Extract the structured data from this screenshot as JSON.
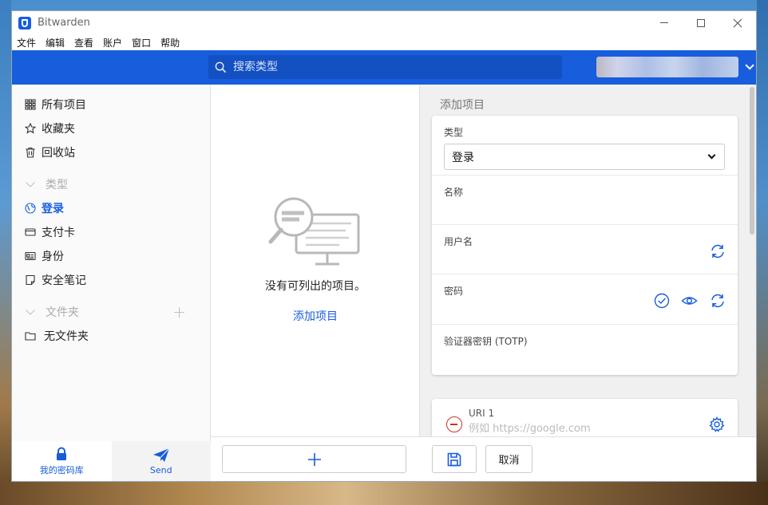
{
  "window": {
    "title": "Bitwarden"
  },
  "menu": [
    "文件",
    "编辑",
    "查看",
    "账户",
    "窗口",
    "帮助"
  ],
  "search": {
    "placeholder": "搜索类型"
  },
  "sidebar": {
    "items": [
      {
        "label": "所有项目",
        "icon": "grid-icon"
      },
      {
        "label": "收藏夹",
        "icon": "star-icon"
      },
      {
        "label": "回收站",
        "icon": "trash-icon"
      }
    ],
    "types_heading": "类型",
    "types": [
      {
        "label": "登录",
        "icon": "globe-icon",
        "active": true
      },
      {
        "label": "支付卡",
        "icon": "credit-card-icon"
      },
      {
        "label": "身份",
        "icon": "id-card-icon"
      },
      {
        "label": "安全笔记",
        "icon": "note-icon"
      }
    ],
    "folders_heading": "文件夹",
    "folders": [
      {
        "label": "无文件夹",
        "icon": "folder-icon"
      }
    ],
    "bottom_tabs": [
      {
        "label": "我的密码库",
        "icon": "lock-icon"
      },
      {
        "label": "Send",
        "icon": "paper-plane-icon"
      }
    ]
  },
  "list": {
    "empty_text": "没有可列出的项目。",
    "add_link": "添加项目",
    "add_button_icon": "plus-icon"
  },
  "detail": {
    "title": "添加项目",
    "type_label": "类型",
    "type_value": "登录",
    "name_label": "名称",
    "username_label": "用户名",
    "password_label": "密码",
    "totp_label": "验证器密钥 (TOTP)",
    "uri_label": "URI 1",
    "uri_placeholder": "例如 https://google.com",
    "cancel_label": "取消"
  },
  "colors": {
    "accent": "#175ddc",
    "danger": "#c83522"
  }
}
